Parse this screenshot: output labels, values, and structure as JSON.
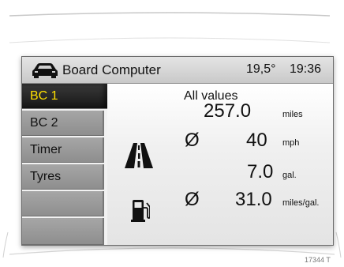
{
  "header": {
    "title": "Board Computer",
    "temperature": "19,5°",
    "time": "19:36"
  },
  "sidebar": {
    "items": [
      {
        "label": "BC 1",
        "active": true
      },
      {
        "label": "BC 2",
        "active": false
      },
      {
        "label": "Timer",
        "active": false
      },
      {
        "label": "Tyres",
        "active": false
      },
      {
        "label": "",
        "active": false
      },
      {
        "label": "",
        "active": false
      }
    ]
  },
  "main": {
    "heading": "All values",
    "distance": {
      "value": "257.0",
      "unit": "miles"
    },
    "avg_speed": {
      "prefix": "Ø",
      "value": "40",
      "unit": "mph"
    },
    "fuel_used": {
      "value": "7.0",
      "unit": "gal."
    },
    "avg_consumption": {
      "prefix": "Ø",
      "value": "31.0",
      "unit": "miles/gal."
    }
  },
  "icons": {
    "header": "car-icon",
    "distance": "road-icon",
    "fuel": "fuel-pump-icon"
  },
  "colors": {
    "active_text": "#ffe000",
    "active_bg": "#1e1e1e",
    "menu_bg": "#9a9a9a"
  },
  "figure_code": "17344 T"
}
